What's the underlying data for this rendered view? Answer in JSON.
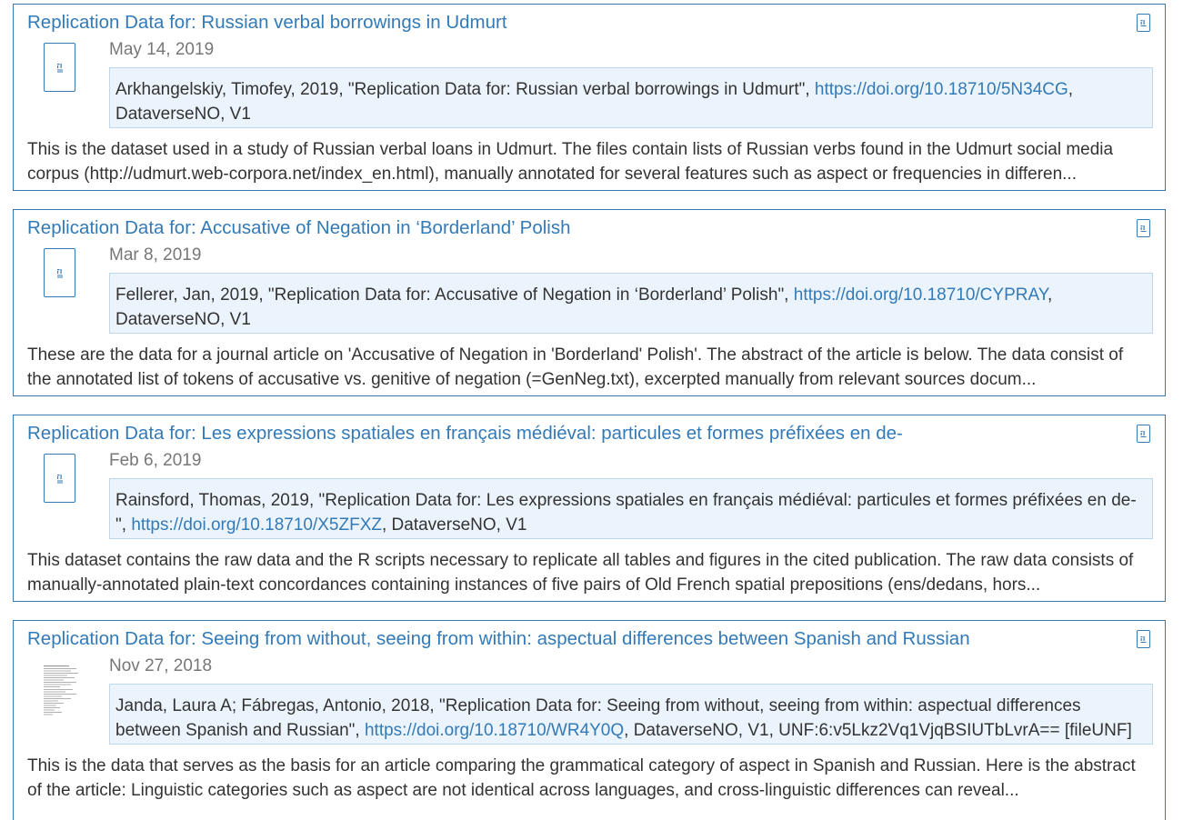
{
  "results": [
    {
      "title": "Replication Data for: Russian verbal borrowings in Udmurt",
      "date": "May 14, 2019",
      "citation_prefix": "Arkhangelskiy, Timofey, 2019, \"Replication Data for: Russian verbal borrowings in Udmurt\", ",
      "doi_link": "https://doi.org/10.18710/5N34CG",
      "citation_suffix": ", DataverseNO, V1",
      "description": "This is the dataset used in a study of Russian verbal loans in Udmurt. The files contain lists of Russian verbs found in the Udmurt social media corpus (http://udmurt.web-corpora.net/index_en.html), manually annotated for several features such as aspect or frequencies in differen...",
      "icon": "file-icon"
    },
    {
      "title": "Replication Data for: Accusative of Negation in ‘Borderland’ Polish",
      "date": "Mar 8, 2019",
      "citation_prefix": "Fellerer, Jan, 2019, \"Replication Data for: Accusative of Negation in ‘Borderland’ Polish\", ",
      "doi_link": "https://doi.org/10.18710/CYPRAY",
      "citation_suffix": ", DataverseNO, V1",
      "description": "These are the data for a journal article on 'Accusative of Negation in 'Borderland' Polish'. The abstract of the article is below. The data consist of the annotated list of tokens of accusative vs. genitive of negation (=GenNeg.txt), excerpted manually from relevant sources docum...",
      "icon": "file-icon"
    },
    {
      "title": "Replication Data for: Les expressions spatiales en français médiéval: particules et formes préfixées en de-",
      "date": "Feb 6, 2019",
      "citation_prefix": "Rainsford, Thomas, 2019, \"Replication Data for: Les expressions spatiales en français médiéval: particules et formes préfixées en de-\", ",
      "doi_link": "https://doi.org/10.18710/X5ZFXZ",
      "citation_suffix": ", DataverseNO, V1",
      "description": "This dataset contains the raw data and the R scripts necessary to replicate all tables and figures in the cited publication. The raw data consists of manually-annotated plain-text concordances containing instances of five pairs of Old French spatial prepositions (ens/dedans, hors...",
      "icon": "file-icon"
    },
    {
      "title": "Replication Data for: Seeing from without, seeing from within: aspectual differences between Spanish and Russian",
      "date": "Nov 27, 2018",
      "citation_prefix": "Janda, Laura A; Fábregas, Antonio, 2018, \"Replication Data for: Seeing from without, seeing from within: aspectual differences between Spanish and Russian\", ",
      "doi_link": "https://doi.org/10.18710/WR4Y0Q",
      "citation_suffix": ", DataverseNO, V1, UNF:6:v5Lkz2Vq1VjqBSIUTbLvrA== [fileUNF]",
      "description": "This is the data that serves as the basis for an article comparing the grammatical category of aspect in Spanish and Russian. Here is the abstract of the article: Linguistic categories such as aspect are not identical across languages, and cross-linguistic differences can reveal...",
      "icon": "document-thumbnail"
    }
  ],
  "colors": {
    "link": "#337ab7",
    "border": "#3c7ab0",
    "citation_bg": "#ebf4fc",
    "date": "#777777",
    "text": "#333333"
  }
}
